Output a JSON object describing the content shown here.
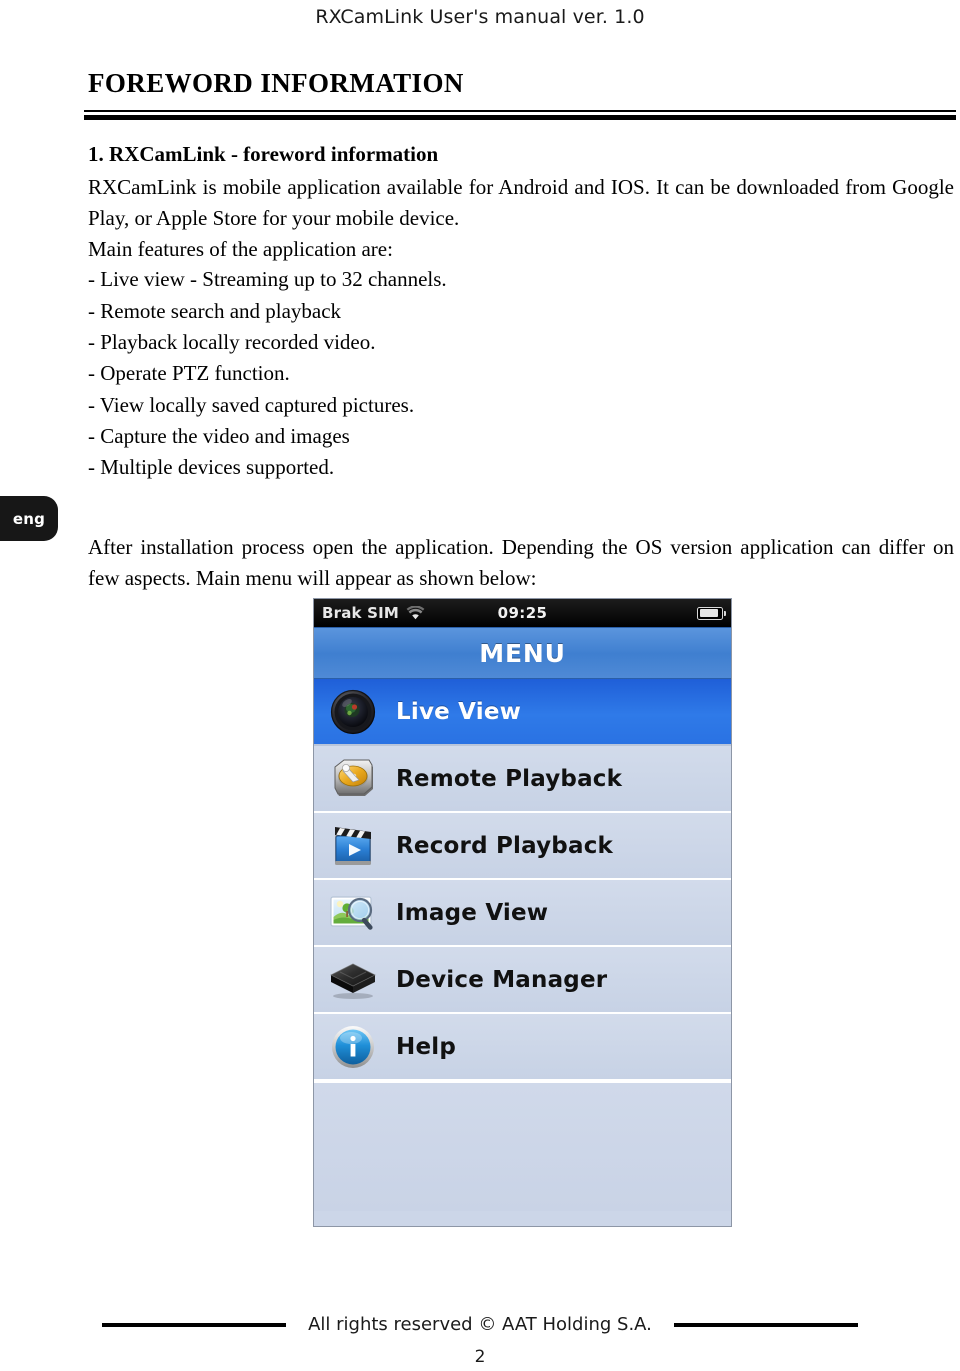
{
  "document": {
    "running_header": "RXCamLink User's manual ver. 1.0",
    "chapter_title": "FOREWORD INFORMATION",
    "language_tab": "eng"
  },
  "section": {
    "heading": "1. RXCamLink - foreword information",
    "intro_paragraph": "RXCamLink is mobile application available for Android and IOS. It can be downloaded from Google Play, or Apple Store for your mobile device.",
    "features_lead": "Main features of the application are:",
    "features": [
      "- Live view - Streaming up to 32 channels.",
      "- Remote search and playback",
      "- Playback locally recorded video.",
      "- Operate PTZ function.",
      "- View locally saved captured pictures.",
      "- Capture the video and images",
      "- Multiple devices supported."
    ],
    "closing_paragraph": "After installation process open the application. Depending the OS version application can differ on few aspects.  Main menu will appear as shown below:"
  },
  "screenshot": {
    "status_bar": {
      "carrier": "Brak SIM",
      "wifi_icon": "wifi-icon",
      "clock": "09:25",
      "battery_icon": "battery-icon"
    },
    "title_bar": {
      "title": "MENU"
    },
    "menu_items": [
      {
        "label": "Live View",
        "icon": "camera-lens-icon",
        "selected": true
      },
      {
        "label": "Remote Playback",
        "icon": "hard-disk-icon",
        "selected": false
      },
      {
        "label": "Record Playback",
        "icon": "clapperboard-icon",
        "selected": false
      },
      {
        "label": "Image View",
        "icon": "photo-magnifier-icon",
        "selected": false
      },
      {
        "label": "Device Manager",
        "icon": "device-box-icon",
        "selected": false
      },
      {
        "label": "Help",
        "icon": "info-circle-icon",
        "selected": false
      }
    ]
  },
  "footer": {
    "copyright": "All rights reserved © AAT Holding S.A.",
    "page_number": "2"
  },
  "colors": {
    "selected_row": "#2a72e3",
    "title_bar": "#3f7fd0",
    "row_background": "#ccd6e8",
    "lang_tab": "#171717"
  }
}
